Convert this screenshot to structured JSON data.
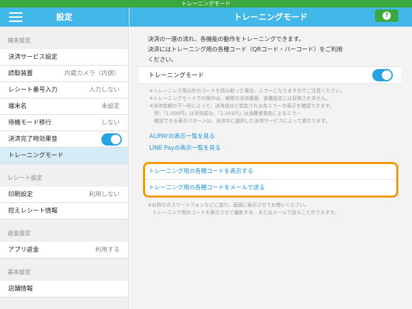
{
  "topbar": {
    "title": "トレーニングモード"
  },
  "sidebar": {
    "title": "設定",
    "sections": [
      {
        "label": "端末設定",
        "items": [
          {
            "label": "決済サービス設定",
            "value": ""
          },
          {
            "label": "読取装置",
            "value": "内蔵カメラ（内側）"
          },
          {
            "label": "レシート番号入力",
            "value": "入力しない"
          },
          {
            "label": "端末名",
            "value": "未設定"
          },
          {
            "label": "待機モード移行",
            "value": "しない"
          },
          {
            "label": "決済完了時効果音",
            "value": "",
            "toggle": true,
            "on": true
          },
          {
            "label": "トレーニングモード",
            "value": "",
            "active": true
          }
        ]
      },
      {
        "label": "レシート設定",
        "items": [
          {
            "label": "印刷設定",
            "value": "利用しない"
          },
          {
            "label": "控えレシート情報",
            "value": ""
          }
        ]
      },
      {
        "label": "返金設定",
        "items": [
          {
            "label": "アプリ返金",
            "value": "利用する"
          }
        ]
      },
      {
        "label": "基本設定",
        "items": [
          {
            "label": "店舗情報",
            "value": ""
          }
        ]
      }
    ]
  },
  "main": {
    "title": "トレーニングモード",
    "description": [
      "決済の一連の流れ、各機能の動作をトレーニングできます。",
      "決済にはトレーニング用の各種コード（QRコード・バーコード）をご利用",
      "ください。"
    ],
    "toggle_row": {
      "label": "トレーニングモード",
      "on": true
    },
    "notes": [
      "※トレーニング用以外のコードを読み取った場合、エラーになりますのでご注意ください。",
      "※トレーニングモードでの操作は、実際の決済履歴、各種設定には反映されません。",
      "※決済金額の下一桁によって、決済成功と想定される各エラーの表示を確認できます。",
      "　例：「1,000円」は決済成功、「1,001円」は消費者事由によるエラー",
      "　確認できる表示パターンは、決済中に選択した決済サービスによって異なります。"
    ],
    "links": {
      "alipay": "ALIPAYの表示一覧を見る",
      "line_pay": "LINE Payの表示一覧を見る"
    },
    "card": {
      "show_codes": "トレーニング用の各種コードを表示する",
      "email_codes": "トレーニング用の各種コードをメールで送る"
    },
    "notes2": [
      "※お持ちのスマートフォンなどに送り、画面に表示させてお使いください。",
      "　トレーニング用のコードを表示させて撮影する、またはメールで送ることができます。"
    ],
    "help_label": "?"
  },
  "colors": {
    "header": "#41b8e8",
    "topbar": "#3aa83f",
    "accent": "#f39800",
    "link": "#1e8fd6",
    "toggle_on": "#27a4e0"
  }
}
